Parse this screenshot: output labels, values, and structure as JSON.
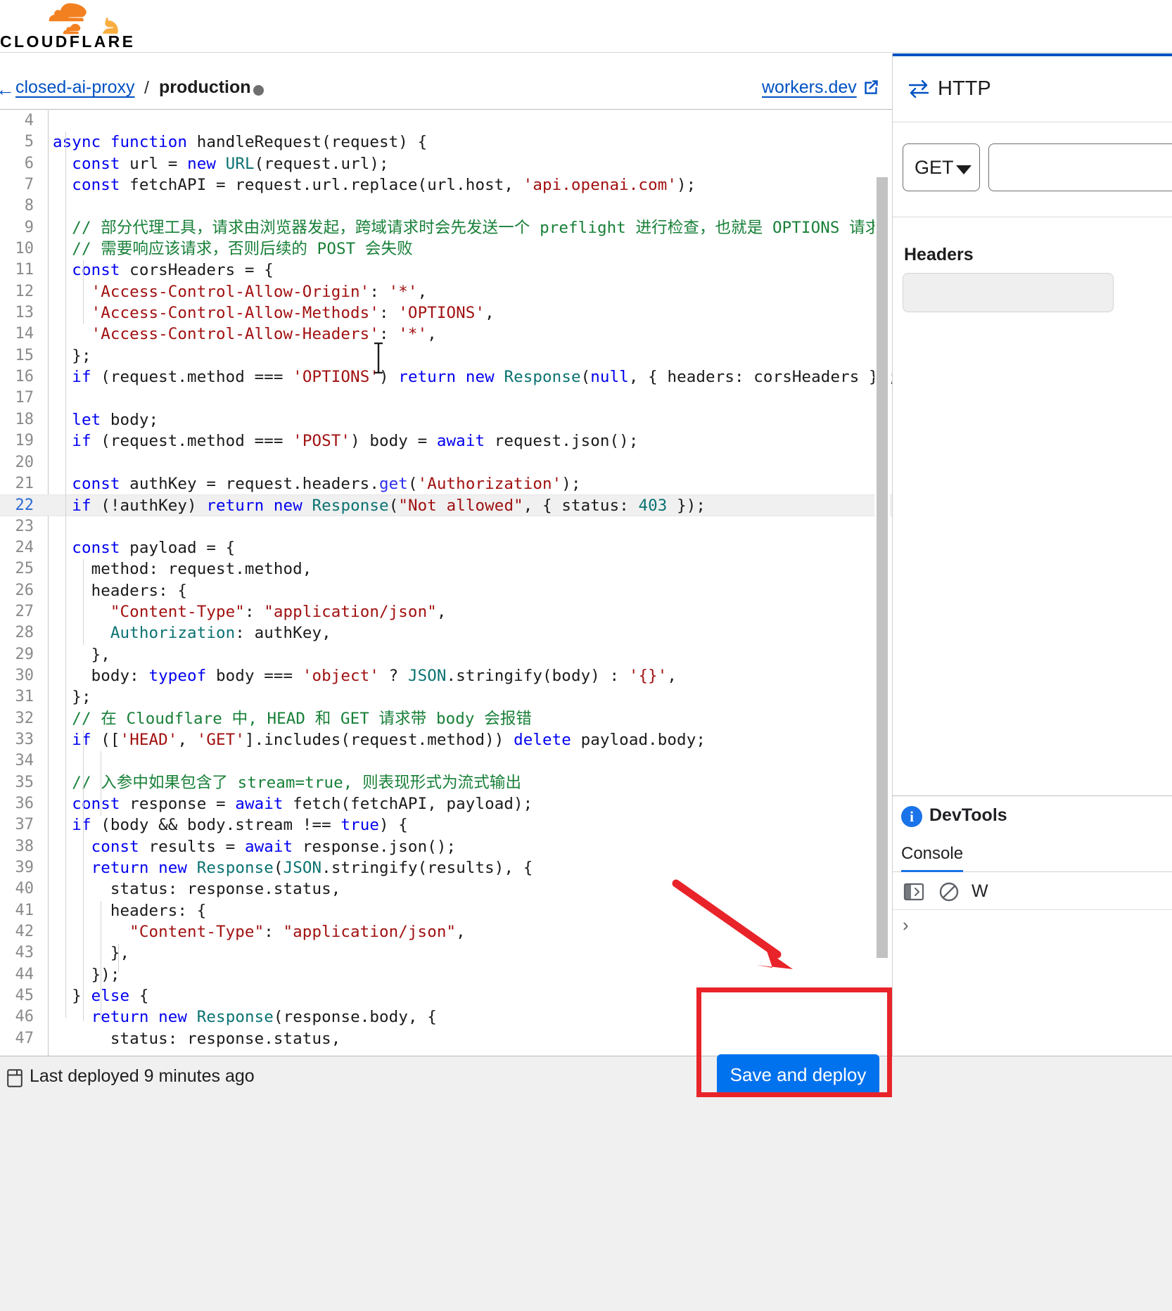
{
  "brand": {
    "logo_icon": "cloudflare-cloud-icon",
    "wordmark": "CLOUDFLARE",
    "orange_dark": "#F38020",
    "orange_light": "#FAAD3F"
  },
  "breadcrumb": {
    "back_glyph": "←",
    "project_link": "closed-ai-proxy",
    "separator": "/",
    "environment": "production",
    "status_dot_color": "#6e6e6e",
    "workers_dev_link": "workers.dev",
    "external_link_icon": "external-link-icon"
  },
  "editor": {
    "first_visible_line": 4,
    "active_line": 22,
    "lines": [
      {
        "n": 4,
        "tokens": []
      },
      {
        "n": 5,
        "tokens": [
          {
            "t": "async ",
            "c": "kw"
          },
          {
            "t": "function ",
            "c": "kw"
          },
          {
            "t": "handleRequest(request) {",
            "c": ""
          }
        ]
      },
      {
        "n": 6,
        "tokens": [
          {
            "t": "  ",
            "c": ""
          },
          {
            "t": "const",
            "c": "kw"
          },
          {
            "t": " url = ",
            "c": ""
          },
          {
            "t": "new",
            "c": "kw"
          },
          {
            "t": " ",
            "c": ""
          },
          {
            "t": "URL",
            "c": "typ"
          },
          {
            "t": "(request.url);",
            "c": ""
          }
        ]
      },
      {
        "n": 7,
        "tokens": [
          {
            "t": "  ",
            "c": ""
          },
          {
            "t": "const",
            "c": "kw"
          },
          {
            "t": " fetchAPI = request.url.replace(url.host, ",
            "c": ""
          },
          {
            "t": "'api.openai.com'",
            "c": "str"
          },
          {
            "t": ");",
            "c": ""
          }
        ]
      },
      {
        "n": 8,
        "tokens": []
      },
      {
        "n": 9,
        "tokens": [
          {
            "t": "  ",
            "c": ""
          },
          {
            "t": "// 部分代理工具，请求由浏览器发起，跨域请求时会先发送一个 preflight 进行检查，也就是 OPTIONS 请求",
            "c": "cmt"
          }
        ]
      },
      {
        "n": 10,
        "tokens": [
          {
            "t": "  ",
            "c": ""
          },
          {
            "t": "// 需要响应该请求，否则后续的 POST 会失败",
            "c": "cmt"
          }
        ]
      },
      {
        "n": 11,
        "tokens": [
          {
            "t": "  ",
            "c": ""
          },
          {
            "t": "const",
            "c": "kw"
          },
          {
            "t": " corsHeaders = {",
            "c": ""
          }
        ]
      },
      {
        "n": 12,
        "tokens": [
          {
            "t": "    ",
            "c": ""
          },
          {
            "t": "'Access-Control-Allow-Origin'",
            "c": "str"
          },
          {
            "t": ": ",
            "c": ""
          },
          {
            "t": "'*'",
            "c": "str"
          },
          {
            "t": ",",
            "c": ""
          }
        ]
      },
      {
        "n": 13,
        "tokens": [
          {
            "t": "    ",
            "c": ""
          },
          {
            "t": "'Access-Control-Allow-Methods'",
            "c": "str"
          },
          {
            "t": ": ",
            "c": ""
          },
          {
            "t": "'OPTIONS'",
            "c": "str"
          },
          {
            "t": ",",
            "c": ""
          }
        ]
      },
      {
        "n": 14,
        "tokens": [
          {
            "t": "    ",
            "c": ""
          },
          {
            "t": "'Access-Control-Allow-Headers'",
            "c": "str"
          },
          {
            "t": ": ",
            "c": ""
          },
          {
            "t": "'*'",
            "c": "str"
          },
          {
            "t": ",",
            "c": ""
          }
        ]
      },
      {
        "n": 15,
        "tokens": [
          {
            "t": "  };",
            "c": ""
          }
        ]
      },
      {
        "n": 16,
        "tokens": [
          {
            "t": "  ",
            "c": ""
          },
          {
            "t": "if",
            "c": "kw"
          },
          {
            "t": " (request.method === ",
            "c": ""
          },
          {
            "t": "'OPTIONS'",
            "c": "str"
          },
          {
            "t": ") ",
            "c": ""
          },
          {
            "t": "return",
            "c": "kw"
          },
          {
            "t": " ",
            "c": ""
          },
          {
            "t": "new",
            "c": "kw"
          },
          {
            "t": " ",
            "c": ""
          },
          {
            "t": "Response",
            "c": "typ"
          },
          {
            "t": "(",
            "c": ""
          },
          {
            "t": "null",
            "c": "kw"
          },
          {
            "t": ", { headers: corsHeaders });",
            "c": ""
          }
        ]
      },
      {
        "n": 17,
        "tokens": []
      },
      {
        "n": 18,
        "tokens": [
          {
            "t": "  ",
            "c": ""
          },
          {
            "t": "let",
            "c": "kw"
          },
          {
            "t": " body;",
            "c": ""
          }
        ]
      },
      {
        "n": 19,
        "tokens": [
          {
            "t": "  ",
            "c": ""
          },
          {
            "t": "if",
            "c": "kw"
          },
          {
            "t": " (request.method === ",
            "c": ""
          },
          {
            "t": "'POST'",
            "c": "str"
          },
          {
            "t": ") body = ",
            "c": ""
          },
          {
            "t": "await",
            "c": "kw"
          },
          {
            "t": " request.json();",
            "c": ""
          }
        ]
      },
      {
        "n": 20,
        "tokens": []
      },
      {
        "n": 21,
        "tokens": [
          {
            "t": "  ",
            "c": ""
          },
          {
            "t": "const",
            "c": "kw"
          },
          {
            "t": " authKey = request.headers.",
            "c": ""
          },
          {
            "t": "get",
            "c": "fn"
          },
          {
            "t": "(",
            "c": ""
          },
          {
            "t": "'Authorization'",
            "c": "str"
          },
          {
            "t": ");",
            "c": ""
          }
        ]
      },
      {
        "n": 22,
        "tokens": [
          {
            "t": "  ",
            "c": ""
          },
          {
            "t": "if",
            "c": "kw"
          },
          {
            "t": " (!authKey) ",
            "c": ""
          },
          {
            "t": "return",
            "c": "kw"
          },
          {
            "t": " ",
            "c": ""
          },
          {
            "t": "new",
            "c": "kw"
          },
          {
            "t": " ",
            "c": ""
          },
          {
            "t": "Response",
            "c": "typ"
          },
          {
            "t": "(",
            "c": ""
          },
          {
            "t": "\"Not allowed\"",
            "c": "str"
          },
          {
            "t": ", { status: ",
            "c": ""
          },
          {
            "t": "403",
            "c": "num"
          },
          {
            "t": " });",
            "c": ""
          }
        ]
      },
      {
        "n": 23,
        "tokens": []
      },
      {
        "n": 24,
        "tokens": [
          {
            "t": "  ",
            "c": ""
          },
          {
            "t": "const",
            "c": "kw"
          },
          {
            "t": " payload = {",
            "c": ""
          }
        ]
      },
      {
        "n": 25,
        "tokens": [
          {
            "t": "    method: request.method,",
            "c": ""
          }
        ]
      },
      {
        "n": 26,
        "tokens": [
          {
            "t": "    headers: {",
            "c": ""
          }
        ]
      },
      {
        "n": 27,
        "tokens": [
          {
            "t": "      ",
            "c": ""
          },
          {
            "t": "\"Content-Type\"",
            "c": "str"
          },
          {
            "t": ": ",
            "c": ""
          },
          {
            "t": "\"application/json\"",
            "c": "str"
          },
          {
            "t": ",",
            "c": ""
          }
        ]
      },
      {
        "n": 28,
        "tokens": [
          {
            "t": "      ",
            "c": ""
          },
          {
            "t": "Authorization",
            "c": "typ"
          },
          {
            "t": ": authKey,",
            "c": ""
          }
        ]
      },
      {
        "n": 29,
        "tokens": [
          {
            "t": "    },",
            "c": ""
          }
        ]
      },
      {
        "n": 30,
        "tokens": [
          {
            "t": "    body: ",
            "c": ""
          },
          {
            "t": "typeof",
            "c": "kw"
          },
          {
            "t": " body === ",
            "c": ""
          },
          {
            "t": "'object'",
            "c": "str"
          },
          {
            "t": " ? ",
            "c": ""
          },
          {
            "t": "JSON",
            "c": "typ"
          },
          {
            "t": ".stringify(body) : ",
            "c": ""
          },
          {
            "t": "'{}'",
            "c": "str"
          },
          {
            "t": ",",
            "c": ""
          }
        ]
      },
      {
        "n": 31,
        "tokens": [
          {
            "t": "  };",
            "c": ""
          }
        ]
      },
      {
        "n": 32,
        "tokens": [
          {
            "t": "  ",
            "c": ""
          },
          {
            "t": "// 在 Cloudflare 中, HEAD 和 GET 请求带 body 会报错",
            "c": "cmt"
          }
        ]
      },
      {
        "n": 33,
        "tokens": [
          {
            "t": "  ",
            "c": ""
          },
          {
            "t": "if",
            "c": "kw"
          },
          {
            "t": " ([",
            "c": ""
          },
          {
            "t": "'HEAD'",
            "c": "str"
          },
          {
            "t": ", ",
            "c": ""
          },
          {
            "t": "'GET'",
            "c": "str"
          },
          {
            "t": "].includes(request.method)) ",
            "c": ""
          },
          {
            "t": "delete",
            "c": "kw"
          },
          {
            "t": " payload.body;",
            "c": ""
          }
        ]
      },
      {
        "n": 34,
        "tokens": []
      },
      {
        "n": 35,
        "tokens": [
          {
            "t": "  ",
            "c": ""
          },
          {
            "t": "// 入参中如果包含了 stream=true, 则表现形式为流式输出",
            "c": "cmt"
          }
        ]
      },
      {
        "n": 36,
        "tokens": [
          {
            "t": "  ",
            "c": ""
          },
          {
            "t": "const",
            "c": "kw"
          },
          {
            "t": " response = ",
            "c": ""
          },
          {
            "t": "await",
            "c": "kw"
          },
          {
            "t": " fetch(fetchAPI, payload);",
            "c": ""
          }
        ]
      },
      {
        "n": 37,
        "tokens": [
          {
            "t": "  ",
            "c": ""
          },
          {
            "t": "if",
            "c": "kw"
          },
          {
            "t": " (body && body.stream !== ",
            "c": ""
          },
          {
            "t": "true",
            "c": "kw"
          },
          {
            "t": ") {",
            "c": ""
          }
        ]
      },
      {
        "n": 38,
        "tokens": [
          {
            "t": "    ",
            "c": ""
          },
          {
            "t": "const",
            "c": "kw"
          },
          {
            "t": " results = ",
            "c": ""
          },
          {
            "t": "await",
            "c": "kw"
          },
          {
            "t": " response.json();",
            "c": ""
          }
        ]
      },
      {
        "n": 39,
        "tokens": [
          {
            "t": "    ",
            "c": ""
          },
          {
            "t": "return",
            "c": "kw"
          },
          {
            "t": " ",
            "c": ""
          },
          {
            "t": "new",
            "c": "kw"
          },
          {
            "t": " ",
            "c": ""
          },
          {
            "t": "Response",
            "c": "typ"
          },
          {
            "t": "(",
            "c": ""
          },
          {
            "t": "JSON",
            "c": "typ"
          },
          {
            "t": ".stringify(results), {",
            "c": ""
          }
        ]
      },
      {
        "n": 40,
        "tokens": [
          {
            "t": "      status: response.status,",
            "c": ""
          }
        ]
      },
      {
        "n": 41,
        "tokens": [
          {
            "t": "      headers: {",
            "c": ""
          }
        ]
      },
      {
        "n": 42,
        "tokens": [
          {
            "t": "        ",
            "c": ""
          },
          {
            "t": "\"Content-Type\"",
            "c": "str"
          },
          {
            "t": ": ",
            "c": ""
          },
          {
            "t": "\"application/json\"",
            "c": "str"
          },
          {
            "t": ",",
            "c": ""
          }
        ]
      },
      {
        "n": 43,
        "tokens": [
          {
            "t": "      },",
            "c": ""
          }
        ]
      },
      {
        "n": 44,
        "tokens": [
          {
            "t": "    });",
            "c": ""
          }
        ]
      },
      {
        "n": 45,
        "tokens": [
          {
            "t": "  } ",
            "c": ""
          },
          {
            "t": "else",
            "c": "kw"
          },
          {
            "t": " {",
            "c": ""
          }
        ]
      },
      {
        "n": 46,
        "tokens": [
          {
            "t": "    ",
            "c": ""
          },
          {
            "t": "return",
            "c": "kw"
          },
          {
            "t": " ",
            "c": ""
          },
          {
            "t": "new",
            "c": "kw"
          },
          {
            "t": " ",
            "c": ""
          },
          {
            "t": "Response",
            "c": "typ"
          },
          {
            "t": "(response.body, {",
            "c": ""
          }
        ]
      },
      {
        "n": 47,
        "tokens": [
          {
            "t": "      status: response.status,",
            "c": ""
          }
        ]
      }
    ],
    "colors": {
      "keyword": "#0000f0",
      "string": "#a11010",
      "comment": "#188038",
      "type": "#0b7272",
      "text": "#1a1a1a",
      "line_number": "#8a8a8a",
      "active_line_bg": "#f0f0f0"
    }
  },
  "http_panel": {
    "swap_icon": "swap-arrows-icon",
    "title": "HTTP",
    "method": "GET",
    "method_caret_icon": "chevron-down-icon",
    "url_value": "",
    "headers_label": "Headers",
    "headers_value": ""
  },
  "devtools": {
    "info_icon": "info-icon",
    "info_glyph": "i",
    "title": "DevTools",
    "tabs": [
      "Console"
    ],
    "active_tab": "Console",
    "toolbar_icons": [
      "sidebar-toggle-icon",
      "clear-console-icon",
      "filter-label"
    ],
    "filter_label": "W",
    "prompt_glyph": "›"
  },
  "footer": {
    "deploy_icon": "deployment-icon",
    "status_text": "Last deployed 9 minutes ago",
    "save_button_label": "Save and deploy",
    "save_button_color": "#0072ed"
  },
  "annotations": {
    "highlight_box_color": "#e8242a",
    "arrow_color": "#e8242a",
    "arrow_icon": "arrow-pointing-down-right-icon"
  }
}
